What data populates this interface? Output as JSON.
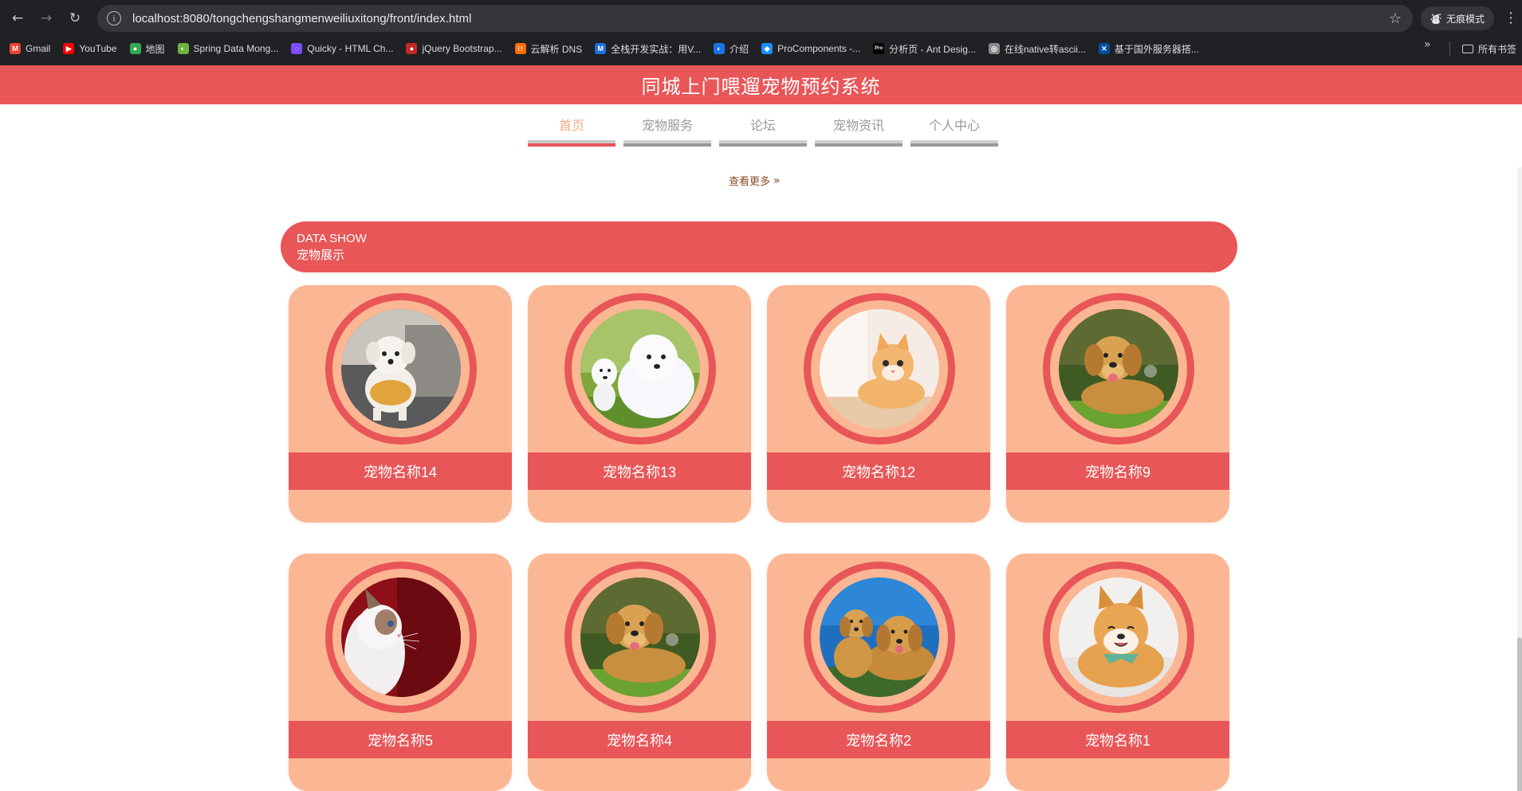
{
  "browser": {
    "url": "localhost:8080/tongchengshangmenweiliuxitong/front/index.html",
    "incognito_label": "无痕模式",
    "bookmarks": [
      {
        "label": "Gmail",
        "color": "#ea4335",
        "glyph": "M"
      },
      {
        "label": "YouTube",
        "color": "#ff0000",
        "glyph": "▶"
      },
      {
        "label": "地图",
        "color": "#34a853",
        "glyph": "●"
      },
      {
        "label": "Spring Data Mong...",
        "color": "#6db33f",
        "glyph": "◐"
      },
      {
        "label": "Quicky - HTML Ch...",
        "color": "#7c4dff",
        "glyph": "◌"
      },
      {
        "label": "jQuery Bootstrap...",
        "color": "#c62828",
        "glyph": "●"
      },
      {
        "label": "云解析 DNS",
        "color": "#ff6a00",
        "glyph": "[-]"
      },
      {
        "label": "全栈开发实战：用V...",
        "color": "#1e6fd9",
        "glyph": "M"
      },
      {
        "label": "介绍",
        "color": "#1a73e8",
        "glyph": "◐"
      },
      {
        "label": "ProComponents -...",
        "color": "#1890ff",
        "glyph": "◆"
      },
      {
        "label": "分析页 - Ant Desig...",
        "color": "#000000",
        "glyph": "Pro"
      },
      {
        "label": "在线native转ascii...",
        "color": "#888888",
        "glyph": "◎"
      },
      {
        "label": "基于国外服务器搭...",
        "color": "#0050a0",
        "glyph": "✕"
      }
    ],
    "all_bookmarks_label": "所有书签"
  },
  "site": {
    "title": "同城上门喂遛宠物预约系统",
    "nav": [
      "首页",
      "宠物服务",
      "论坛",
      "宠物资讯",
      "个人中心"
    ],
    "more_label": "查看更多"
  },
  "section": {
    "en": "DATA SHOW",
    "cn": "宠物展示"
  },
  "pets": [
    {
      "name": "宠物名称14",
      "art": "white-puppy"
    },
    {
      "name": "宠物名称13",
      "art": "samoyed"
    },
    {
      "name": "宠物名称12",
      "art": "orange-cat"
    },
    {
      "name": "宠物名称9",
      "art": "golden-retriever"
    },
    {
      "name": "宠物名称5",
      "art": "ragdoll-cat"
    },
    {
      "name": "宠物名称4",
      "art": "golden-retriever"
    },
    {
      "name": "宠物名称2",
      "art": "two-goldens"
    },
    {
      "name": "宠物名称1",
      "art": "shiba-inu"
    }
  ],
  "colors": {
    "brand": "#e85658",
    "card": "#fbb793",
    "nav_active": "#f9a98a"
  }
}
